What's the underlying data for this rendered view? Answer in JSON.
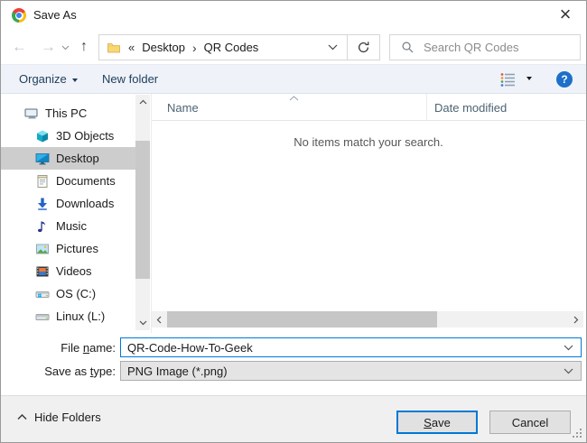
{
  "window": {
    "title": "Save As",
    "close_glyph": "×"
  },
  "navigation": {
    "back_glyph": "←",
    "forward_glyph": "→",
    "up_glyph": "↑",
    "breadcrumb": {
      "overflow_glyph": "«",
      "separator_glyph": "›",
      "items": [
        "Desktop",
        "QR Codes"
      ]
    },
    "search_placeholder": "Search QR Codes"
  },
  "toolbar": {
    "organize_label": "Organize",
    "new_folder_label": "New folder",
    "help_glyph": "?"
  },
  "sidebar": {
    "items": [
      {
        "label": "This PC",
        "icon": "computer-icon",
        "selected": false
      },
      {
        "label": "3D Objects",
        "icon": "3d-objects-icon",
        "selected": false
      },
      {
        "label": "Desktop",
        "icon": "desktop-icon",
        "selected": true
      },
      {
        "label": "Documents",
        "icon": "documents-icon",
        "selected": false
      },
      {
        "label": "Downloads",
        "icon": "downloads-icon",
        "selected": false
      },
      {
        "label": "Music",
        "icon": "music-icon",
        "selected": false
      },
      {
        "label": "Pictures",
        "icon": "pictures-icon",
        "selected": false
      },
      {
        "label": "Videos",
        "icon": "videos-icon",
        "selected": false
      },
      {
        "label": "OS (C:)",
        "icon": "os-drive-icon",
        "selected": false
      },
      {
        "label": "Linux (L:)",
        "icon": "linux-drive-icon",
        "selected": false
      }
    ]
  },
  "file_list": {
    "columns": [
      "Name",
      "Date modified"
    ],
    "empty_message": "No items match your search."
  },
  "fields": {
    "file_name": {
      "label": "File name:",
      "value": "QR-Code-How-To-Geek",
      "accesskey": "n"
    },
    "save_as_type": {
      "label": "Save as type:",
      "value": "PNG Image (*.png)",
      "accesskey": "t"
    }
  },
  "footer": {
    "hide_folders_label": "Hide Folders",
    "save_label": "Save",
    "save_accesskey": "S",
    "cancel_label": "Cancel"
  },
  "colors": {
    "accent": "#0078d7",
    "selection_bg": "#cdcdcd",
    "toolbar_bg": "#eff3f9",
    "toolbar_text": "#1e3c5a",
    "help_icon_bg": "#1d6fc9"
  }
}
